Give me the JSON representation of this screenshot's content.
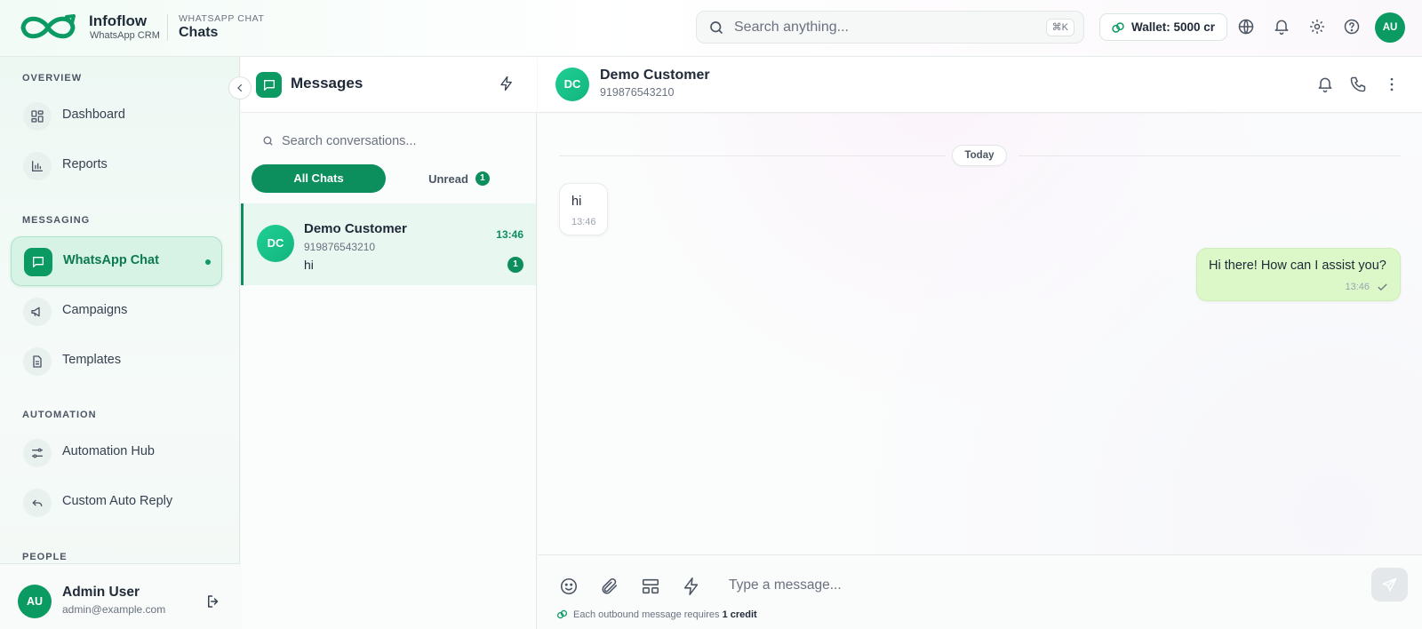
{
  "brand": {
    "name": "Infoflow",
    "subtitle": "WhatsApp CRM"
  },
  "breadcrumb": {
    "section": "WHATSAPP CHAT",
    "page": "Chats"
  },
  "global_search": {
    "placeholder": "Search anything...",
    "shortcut": "⌘K"
  },
  "wallet": {
    "label": "Wallet: 5000 cr"
  },
  "top_icons": [
    "globe-icon",
    "bell-icon",
    "gear-icon",
    "help-icon"
  ],
  "profile": {
    "initials": "AU"
  },
  "sidebar": {
    "sections": {
      "overview": "OVERVIEW",
      "messaging": "MESSAGING",
      "automation": "AUTOMATION",
      "people": "PEOPLE"
    },
    "items": {
      "dashboard": "Dashboard",
      "reports": "Reports",
      "whatsapp_chat": "WhatsApp Chat",
      "campaigns": "Campaigns",
      "templates": "Templates",
      "automation_hub": "Automation Hub",
      "custom_auto_reply": "Custom Auto Reply"
    },
    "active_item": "whatsapp_chat",
    "user": {
      "initials": "AU",
      "name": "Admin User",
      "email": "admin@example.com"
    }
  },
  "conversations": {
    "title": "Messages",
    "search_placeholder": "Search conversations...",
    "tabs": {
      "all": "All Chats",
      "unread": "Unread",
      "unread_count": "1"
    },
    "items": [
      {
        "initials": "DC",
        "name": "Demo Customer",
        "phone": "919876543210",
        "last_message": "hi",
        "time": "13:46",
        "unread": "1"
      }
    ]
  },
  "chat": {
    "contact": {
      "initials": "DC",
      "name": "Demo Customer",
      "phone": "919876543210"
    },
    "date_divider": "Today",
    "messages": [
      {
        "direction": "in",
        "text": "hi",
        "time": "13:46"
      },
      {
        "direction": "out",
        "text": "Hi there! How can I assist you?",
        "time": "13:46",
        "status": "sent"
      }
    ],
    "composer": {
      "placeholder": "Type a message...",
      "note_prefix": "Each outbound message requires",
      "note_credit": "1 credit"
    }
  },
  "colors": {
    "accent": "#0c9a63",
    "outgoing_bubble": "#dcf8c8",
    "active_nav": "#d7f3e6"
  }
}
